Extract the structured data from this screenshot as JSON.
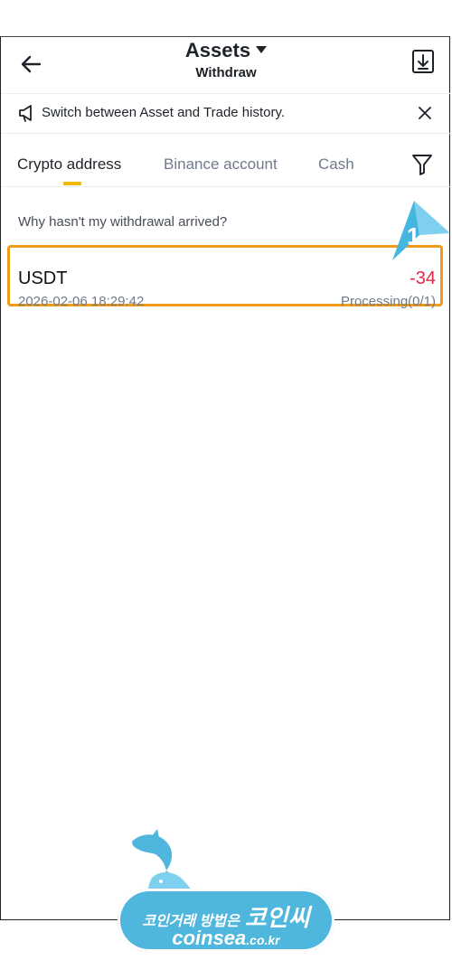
{
  "header": {
    "title": "Assets",
    "subtitle": "Withdraw"
  },
  "notice": {
    "text": "Switch between Asset and Trade history."
  },
  "tabs": [
    {
      "label": "Crypto address",
      "active": true
    },
    {
      "label": "Binance account",
      "active": false
    },
    {
      "label": "Cash",
      "active": false
    }
  ],
  "help": {
    "text": "Why hasn't my withdrawal arrived?"
  },
  "records": [
    {
      "asset": "USDT",
      "amount": "-34",
      "time": "2026-02-06 18:29:42",
      "status": "Processing(0/1)"
    }
  ],
  "annotation": {
    "step": "1"
  },
  "watermark": {
    "line1": "코인거래 방법은",
    "line1_big": "코인씨",
    "line2": "coinsea",
    "line2_suffix": ".co.kr"
  },
  "colors": {
    "accent": "#f0b90b",
    "negative": "#e0294a",
    "highlight_border": "#f29b19",
    "annotation": "#45b6e0"
  },
  "icons": {
    "back": "arrow-left-icon",
    "download": "download-icon",
    "speaker": "megaphone-icon",
    "close": "close-icon",
    "filter": "filter-icon",
    "chevron": "chevron-right-icon"
  }
}
